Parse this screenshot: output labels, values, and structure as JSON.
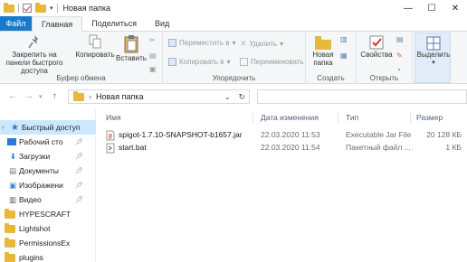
{
  "window": {
    "title": "Новая папка",
    "minimize": "—",
    "maximize": "☐",
    "close": "✕"
  },
  "quick_access_toolbar": {
    "dropdown": "▾"
  },
  "ribbon_tabs": [
    {
      "label": "Файл"
    },
    {
      "label": "Главная"
    },
    {
      "label": "Поделиться"
    },
    {
      "label": "Вид"
    }
  ],
  "ribbon": {
    "clipboard": {
      "label": "Буфер обмена",
      "pin": "Закрепить на панели быстрого доступа",
      "copy": "Копировать",
      "paste": "Вставить"
    },
    "organize": {
      "label": "Упорядочить",
      "move_to": "Переместить в",
      "copy_to": "Копировать в",
      "delete": "Удалить",
      "rename": "Переименовать"
    },
    "create": {
      "label": "Создать",
      "new_folder": "Новая папка"
    },
    "open": {
      "label": "Открыть",
      "properties": "Свойства"
    },
    "select": {
      "label": "Выделить"
    }
  },
  "address_bar": {
    "separator": "›",
    "path": "Новая папка",
    "chevron": "⌄",
    "refresh": "↻"
  },
  "nav_pane": [
    {
      "label": "Быстрый доступ",
      "icon": "star-icon",
      "selected": true
    },
    {
      "label": "Рабочий сто",
      "icon": "desktop-icon",
      "pinned": true
    },
    {
      "label": "Загрузки",
      "icon": "download-icon",
      "pinned": true
    },
    {
      "label": "Документы",
      "icon": "documents-icon",
      "pinned": true
    },
    {
      "label": "Изображени",
      "icon": "pictures-icon",
      "pinned": true
    },
    {
      "label": "Видео",
      "icon": "video-icon",
      "pinned": true
    },
    {
      "label": "HYPESCRAFT",
      "icon": "folder-icon"
    },
    {
      "label": "Lightshot",
      "icon": "folder-icon"
    },
    {
      "label": "PermissionsEx",
      "icon": "folder-icon"
    },
    {
      "label": "plugins",
      "icon": "folder-icon"
    }
  ],
  "columns": {
    "name": "Имя",
    "date": "Дата изменения",
    "type": "Тип",
    "size": "Размер"
  },
  "files": [
    {
      "name": "spigot-1.7.10-SNAPSHOT-b1657.jar",
      "date": "22.03.2020 11:53",
      "type": "Executable Jar File",
      "size": "20 128 КБ",
      "icon": "jar-icon"
    },
    {
      "name": "start.bat",
      "date": "22.03.2020 11:54",
      "type": "Пакетный файл ...",
      "size": "1 КБ",
      "icon": "bat-icon"
    }
  ],
  "colors": {
    "file_tab": "#1979ca",
    "selection": "#cce8ff",
    "folder": "#e8b83a"
  }
}
